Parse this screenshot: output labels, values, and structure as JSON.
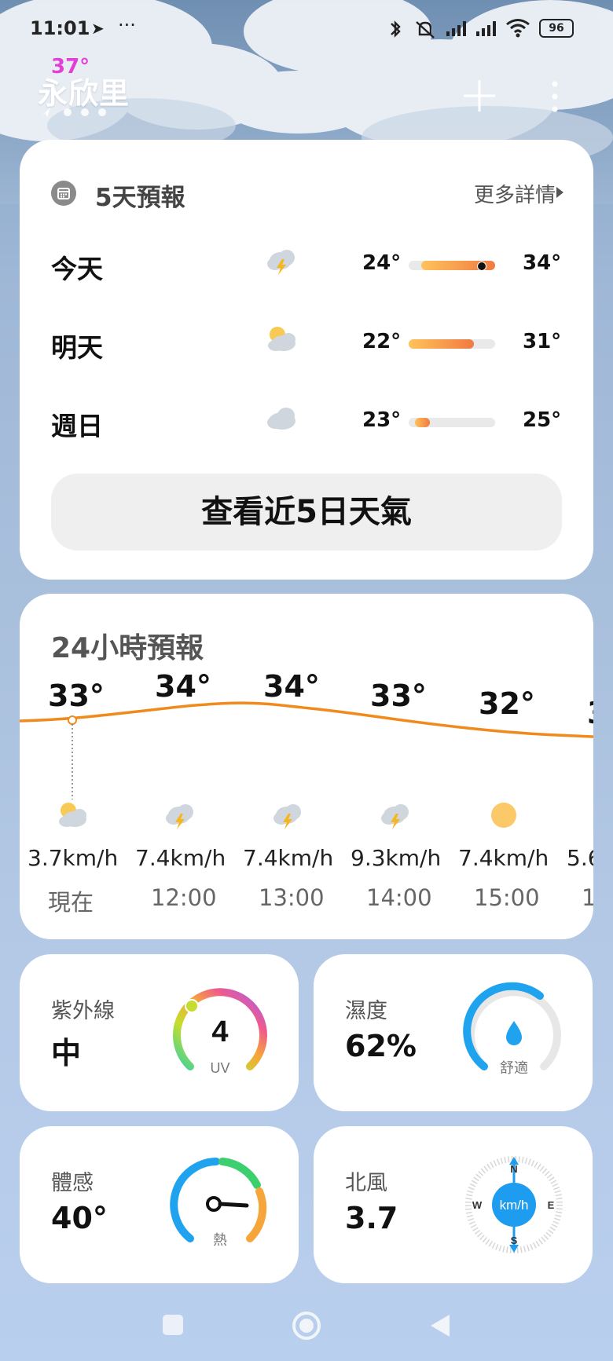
{
  "status": {
    "time": "11:01",
    "dots": "···",
    "battery": "96"
  },
  "location": {
    "temp": "37°",
    "name": "永欣里"
  },
  "forecast5": {
    "title": "5天預報",
    "more": "更多詳情",
    "rows": [
      {
        "day": "今天",
        "icon": "thunder-cloud-icon",
        "lo": "24°",
        "hi": "34°",
        "range_start": 0.15,
        "range_end": 1.0,
        "current": 0.85
      },
      {
        "day": "明天",
        "icon": "partly-cloudy-icon",
        "lo": "22°",
        "hi": "31°",
        "range_start": 0.0,
        "range_end": 0.75
      },
      {
        "day": "週日",
        "icon": "cloud-icon",
        "lo": "23°",
        "hi": "25°",
        "range_start": 0.07,
        "range_end": 0.25
      }
    ],
    "view_button": "查看近5日天氣"
  },
  "hourly": {
    "title": "24小時預報",
    "temps": [
      "33°",
      "34°",
      "34°",
      "33°",
      "32°",
      "3"
    ],
    "winds": [
      "3.7km/h",
      "7.4km/h",
      "7.4km/h",
      "9.3km/h",
      "7.4km/h",
      "5.6"
    ],
    "times": [
      "現在",
      "12:00",
      "13:00",
      "14:00",
      "15:00",
      "1"
    ],
    "icons": [
      "partly-cloudy-icon",
      "thunder-cloud-icon",
      "thunder-cloud-icon",
      "thunder-cloud-icon",
      "sun-icon"
    ]
  },
  "metrics": {
    "uv": {
      "label": "紫外線",
      "value": "中",
      "gauge_value": "4",
      "gauge_unit": "UV"
    },
    "humidity": {
      "label": "濕度",
      "value": "62%",
      "gauge_caption": "舒適"
    },
    "feels": {
      "label": "體感",
      "value": "40°",
      "gauge_caption": "熱"
    },
    "wind": {
      "label": "北風",
      "value": "3.7",
      "unit": "km/h",
      "n": "N",
      "s": "S",
      "e": "E",
      "w": "W"
    }
  },
  "colors": {
    "accent_orange": "#f08a1c",
    "humidity_blue": "#1fa3ef",
    "compass_blue": "#1e9cf0"
  }
}
